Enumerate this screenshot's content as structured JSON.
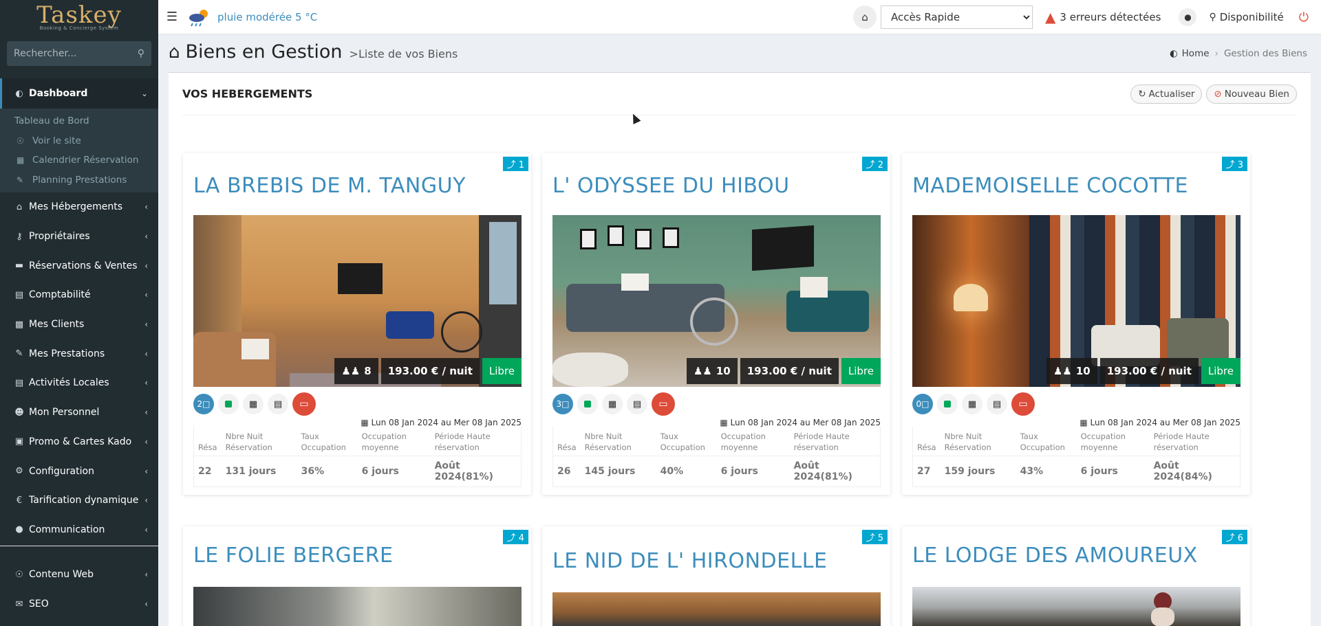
{
  "sidebar": {
    "logo": "Taskey",
    "logo_sub": "Booking & Concierge System",
    "search_placeholder": "Rechercher...",
    "active": {
      "label": "Dashboard",
      "icon": "dashboard-icon"
    },
    "subitems": [
      {
        "label": "Tableau de Bord"
      },
      {
        "label": "Voir le site",
        "icon": "globe-icon"
      },
      {
        "label": "Calendrier Réservation",
        "icon": "calendar-icon"
      },
      {
        "label": "Planning Prestations",
        "icon": "pencil-icon"
      }
    ],
    "items": [
      {
        "label": "Mes Hébergements",
        "icon": "home-icon"
      },
      {
        "label": "Propriétaires",
        "icon": "key-icon"
      },
      {
        "label": "Réservations & Ventes",
        "icon": "credit-card-icon"
      },
      {
        "label": "Comptabilité",
        "icon": "calculator-icon"
      },
      {
        "label": "Mes Clients",
        "icon": "address-book-icon"
      },
      {
        "label": "Mes Prestations",
        "icon": "pencil-icon"
      },
      {
        "label": "Activités Locales",
        "icon": "map-icon"
      },
      {
        "label": "Mon Personnel",
        "icon": "user-circle-icon"
      },
      {
        "label": "Promo & Cartes Kado",
        "icon": "gift-icon"
      },
      {
        "label": "Configuration",
        "icon": "cogs-icon"
      },
      {
        "label": "Tarification dynamique",
        "icon": "euro-icon"
      },
      {
        "label": "Communication",
        "icon": "comment-icon"
      }
    ],
    "bottom_items": [
      {
        "label": "Contenu Web",
        "icon": "globe-icon"
      },
      {
        "label": "SEO",
        "icon": "envelope-icon"
      }
    ]
  },
  "topbar": {
    "weather": "pluie modérée 5 °C",
    "quick_access": "Accès Rapide",
    "errors": "3 erreurs détectées",
    "disponibilite": "Disponibilité"
  },
  "header": {
    "title": "Biens en Gestion",
    "subtitle": ">Liste de vos Biens",
    "breadcrumb_home": "Home",
    "breadcrumb_current": "Gestion des Biens"
  },
  "box": {
    "title": "VOS HEBERGEMENTS",
    "refresh_label": "Actualiser",
    "new_label": "Nouveau Bien"
  },
  "stat_headers": {
    "resa": "Résa",
    "nights": "Nbre Nuit Réservation",
    "rate": "Taux Occupation",
    "avg": "Occupation moyenne",
    "peak": "Période Haute réservation"
  },
  "cards": [
    {
      "num": "1",
      "title": "LA BREBIS DE M. TANGUY",
      "guests": "8",
      "price": "193.00 € / nuit",
      "status": "Libre",
      "messages": "2",
      "dates": "Lun 08 Jan 2024 au Mer 08 Jan 2025",
      "resa": "22",
      "nights": "131 jours",
      "rate": "36%",
      "avg": "6 jours",
      "peak": "Août 2024(81%)"
    },
    {
      "num": "2",
      "title": "L' ODYSSEE DU HIBOU",
      "guests": "10",
      "price": "193.00 € / nuit",
      "status": "Libre",
      "messages": "3",
      "dates": "Lun 08 Jan 2024 au Mer 08 Jan 2025",
      "resa": "26",
      "nights": "145 jours",
      "rate": "40%",
      "avg": "6 jours",
      "peak": "Août 2024(81%)"
    },
    {
      "num": "3",
      "title": "MADEMOISELLE COCOTTE",
      "guests": "10",
      "price": "193.00 € / nuit",
      "status": "Libre",
      "messages": "0",
      "dates": "Lun 08 Jan 2024 au Mer 08 Jan 2025",
      "resa": "27",
      "nights": "159 jours",
      "rate": "43%",
      "avg": "6 jours",
      "peak": "Août 2024(84%)"
    },
    {
      "num": "4",
      "title": "LE FOLIE BERGERE"
    },
    {
      "num": "5",
      "title": "LE NID DE L' HIRONDELLE"
    },
    {
      "num": "6",
      "title": "LE LODGE DES AMOUREUX"
    }
  ]
}
